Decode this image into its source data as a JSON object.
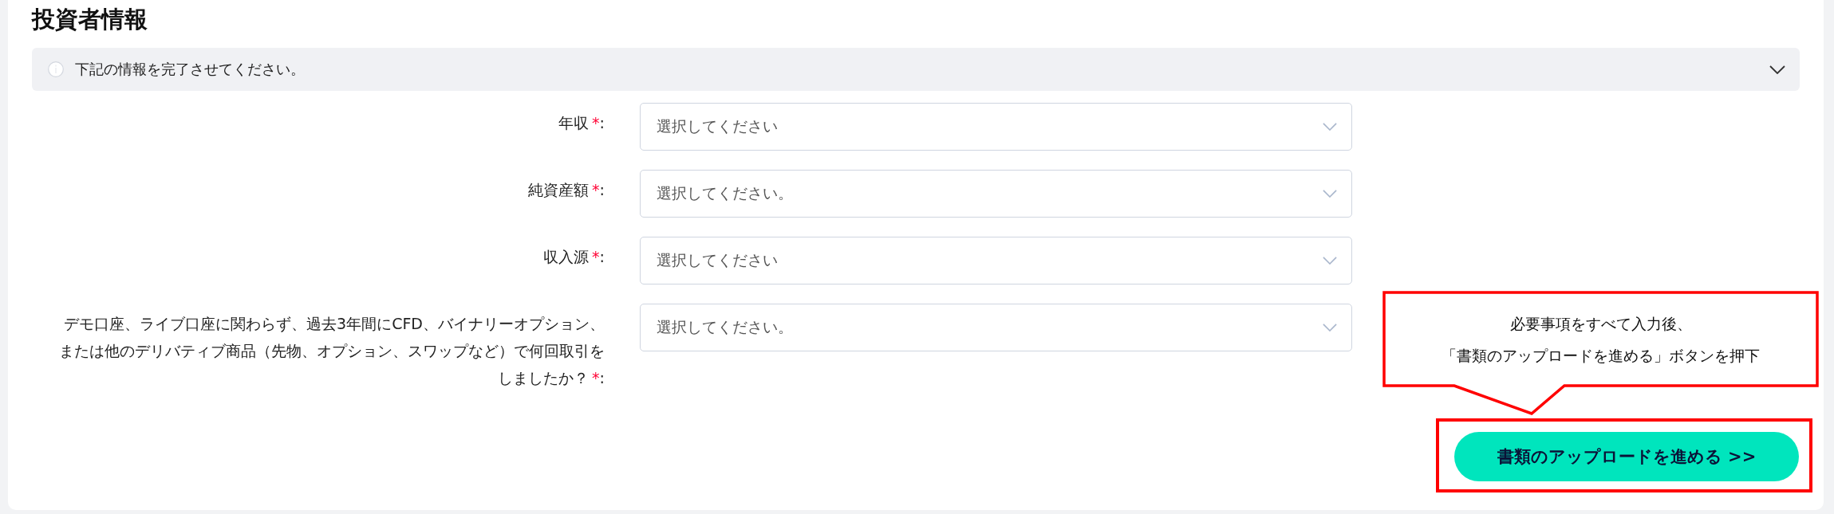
{
  "title": "投資者情報",
  "info": {
    "text": "下記の情報を完了させてください。",
    "expanded": false
  },
  "required_mark": "*",
  "label_suffix": ":",
  "fields": [
    {
      "label": "年収",
      "required": true,
      "placeholder": "選択してください"
    },
    {
      "label": "純資産額",
      "required": true,
      "placeholder": "選択してください。"
    },
    {
      "label": "収入源",
      "required": true,
      "placeholder": "選択してください"
    },
    {
      "label": "デモ口座、ライブ口座に関わらず、過去3年間にCFD、バイナリーオプション、または他のデリバティブ商品（先物、オプション、スワップなど）で何回取引をしましたか？",
      "required": true,
      "placeholder": "選択してください。"
    }
  ],
  "callout": {
    "lines": [
      "必要事項をすべて入力後、",
      "「書類のアップロードを進める」ボタンを押下"
    ]
  },
  "button": {
    "label": "書類のアップロードを進める >>"
  }
}
